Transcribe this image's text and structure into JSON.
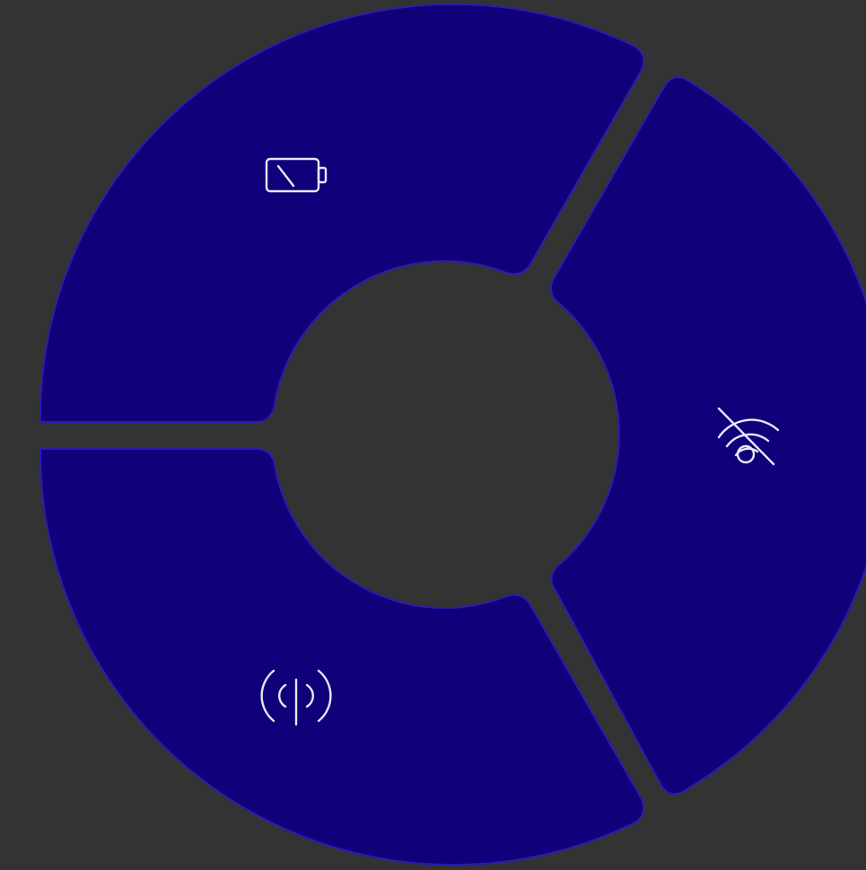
{
  "menu": {
    "background_color": "#333333",
    "segment_fill": "#10007a",
    "segment_border": "#2a1cb0",
    "icon_color": "#e9e6f5",
    "segments": [
      {
        "name": "battery",
        "icon": "battery-empty-icon"
      },
      {
        "name": "wifi",
        "icon": "wifi-off-icon"
      },
      {
        "name": "cellular",
        "icon": "antenna-signal-icon"
      }
    ]
  }
}
